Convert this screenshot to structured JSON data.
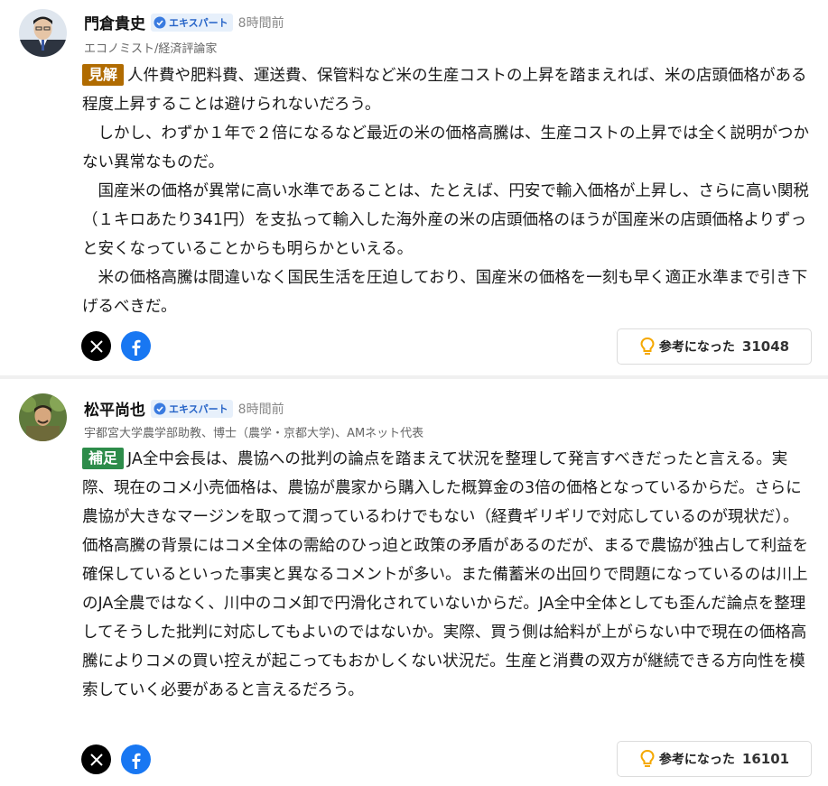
{
  "comments": [
    {
      "author": "門倉貴史",
      "badge": "エキスパート",
      "time": "8時間前",
      "affiliation": "エコノミスト/経済評論家",
      "tag": "見解",
      "tag_color": "#b06b00",
      "paragraphs": [
        "人件費や肥料費、運送費、保管料など米の生産コストの上昇を踏まえれば、米の店頭価格がある程度上昇することは避けられないだろう。",
        "しかし、わずか１年で２倍になるなど最近の米の価格高騰は、生産コストの上昇では全く説明がつかない異常なものだ。",
        "国産米の価格が異常に高い水準であることは、たとえば、円安で輸入価格が上昇し、さらに高い関税（１キロあたり341円）を支払って輸入した海外産の米の店頭価格のほうが国産米の店頭価格よりずっと安くなっていることからも明らかといえる。",
        "米の価格高騰は間違いなく国民生活を圧迫しており、国産米の価格を一刻も早く適正水準まで引き下げるべきだ。"
      ],
      "helpful_label": "参考になった",
      "helpful_count": "31048",
      "icons": [
        "x-logo-icon",
        "facebook-icon",
        "lightbulb-icon",
        "verified-check-icon"
      ]
    },
    {
      "author": "松平尚也",
      "badge": "エキスパート",
      "time": "8時間前",
      "affiliation": "宇都宮大学農学部助教、博士（農学・京都大学)、AMネット代表",
      "tag": "補足",
      "tag_color": "#2d8c4a",
      "paragraphs": [
        "JA全中会長は、農協への批判の論点を踏まえて状況を整理して発言すべきだったと言える。実際、現在のコメ小売価格は、農協が農家から購入した概算金の3倍の価格となっているからだ。さらに農協が大きなマージンを取って潤っているわけでもない（経費ギリギリで対応しているのが現状だ）。価格高騰の背景にはコメ全体の需給のひっ迫と政策の矛盾があるのだが、まるで農協が独占して利益を確保しているといった事実と異なるコメントが多い。また備蓄米の出回りで問題になっているのは川上のJA全農ではなく、川中のコメ卸で円滑化されていないからだ。JA全中全体としても歪んだ論点を整理してそうした批判に対応してもよいのではないか。実際、買う側は給料が上がらない中で現在の価格高騰によりコメの買い控えが起こってもおかしくない状況だ。生産と消費の双方が継続できる方向性を模索していく必要があると言えるだろう。"
      ],
      "helpful_label": "参考になった",
      "helpful_count": "16101",
      "icons": [
        "x-logo-icon",
        "facebook-icon",
        "lightbulb-icon",
        "verified-check-icon"
      ]
    }
  ],
  "colors": {
    "badge_text": "#2563c7",
    "badge_bg": "#e7f0fb",
    "lightbulb": "#f5a800",
    "facebook": "#1877f2"
  }
}
